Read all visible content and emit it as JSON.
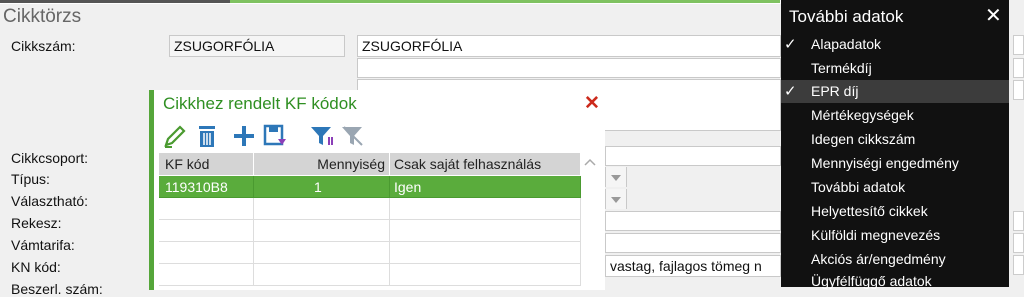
{
  "window": {
    "title": "Cikktörzs"
  },
  "form": {
    "labels": {
      "cikkszam": "Cikkszám:",
      "cikkcsoport": "Cikkcsoport:",
      "tipus": "Típus:",
      "valaszthato": "Választható:",
      "rekesz": "Rekesz:",
      "vamtarifa": "Vámtarifa:",
      "kn_kod": "KN kód:",
      "partial_bottom": "Beszerl. szám:"
    },
    "cikkszam_code": "ZSUGORFÓLIA",
    "cikkszam_name": "ZSUGORFÓLIA",
    "kn_description_visible": "vastag, fajlagos tömeg n"
  },
  "dialog": {
    "title": "Cikkhez rendelt KF kódok",
    "toolbar_icons": [
      "edit-icon",
      "trash-icon",
      "add-icon",
      "save-icon",
      "filter-icon",
      "filter-clear-icon"
    ],
    "columns": [
      "KF kód",
      "Mennyiség",
      "Csak saját felhasználás"
    ],
    "rows": [
      {
        "kf_kod": "119310B8",
        "mennyiseg": "1",
        "csak_sajat": "Igen",
        "selected": true
      }
    ],
    "accent_color": "#55a63a"
  },
  "panel": {
    "title": "További adatok",
    "items": [
      {
        "label": "Alapadatok",
        "checked": true
      },
      {
        "label": "Termékdíj",
        "checked": false
      },
      {
        "label": "EPR díj",
        "checked": true,
        "highlighted": true
      },
      {
        "label": "Mértékegységek",
        "checked": false
      },
      {
        "label": "Idegen cikkszám",
        "checked": false
      },
      {
        "label": "Mennyiségi engedmény",
        "checked": false
      },
      {
        "label": "További adatok",
        "checked": false
      },
      {
        "label": "Helyettesítő cikkek",
        "checked": false
      },
      {
        "label": "Külföldi megnevezés",
        "checked": false
      },
      {
        "label": "Akciós ár/engedmény",
        "checked": false
      },
      {
        "label": "Ügyfélfüggő adatok",
        "checked": false
      }
    ],
    "check_glyph": "✓"
  }
}
